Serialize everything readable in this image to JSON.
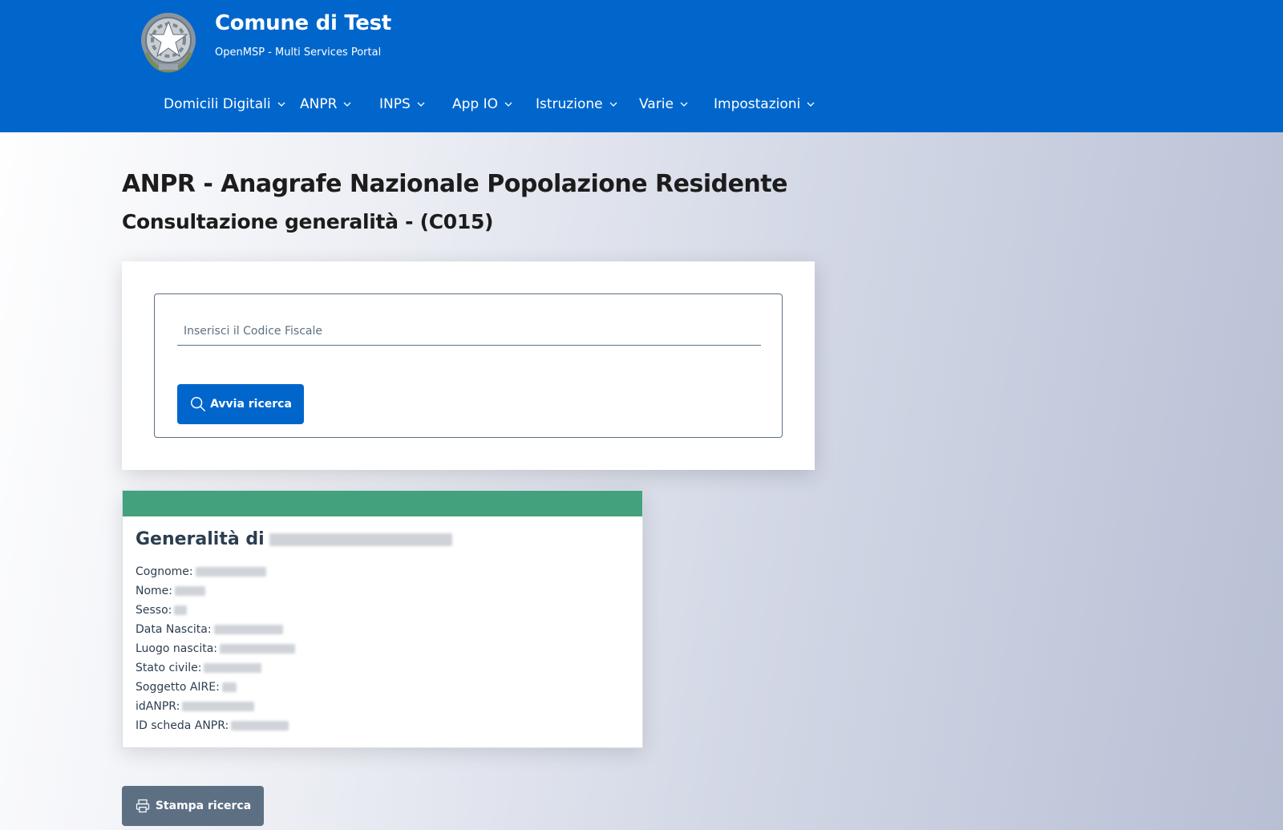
{
  "header": {
    "title": "Comune di Test",
    "subtitle": "OpenMSP - Multi Services Portal",
    "nav": [
      {
        "label": "Domicili Digitali"
      },
      {
        "label": "ANPR"
      },
      {
        "label": "INPS"
      },
      {
        "label": "App IO"
      },
      {
        "label": "Istruzione"
      },
      {
        "label": "Varie"
      },
      {
        "label": "Impostazioni"
      }
    ]
  },
  "page": {
    "title": "ANPR - Anagrafe Nazionale Popolazione Residente",
    "subtitle": "Consultazione generalità - (C015)"
  },
  "search": {
    "placeholder": "Inserisci il Codice Fiscale",
    "value": "",
    "button_label": "Avvia ricerca",
    "button_icon": "search-icon"
  },
  "result": {
    "title_prefix": "Generalità di",
    "band_color": "#43a17d",
    "fields": [
      {
        "label": "Cognome:"
      },
      {
        "label": "Nome:"
      },
      {
        "label": "Sesso:"
      },
      {
        "label": "Data Nascita:"
      },
      {
        "label": "Luogo nascita:"
      },
      {
        "label": "Stato civile:"
      },
      {
        "label": "Soggetto AIRE:"
      },
      {
        "label": "idANPR:"
      },
      {
        "label": "ID scheda ANPR:"
      }
    ]
  },
  "actions": {
    "print_label": "Stampa ricerca",
    "print_icon": "printer-icon"
  },
  "colors": {
    "primary": "#0066cc",
    "secondary": "#5d7083",
    "success": "#43a17d"
  }
}
